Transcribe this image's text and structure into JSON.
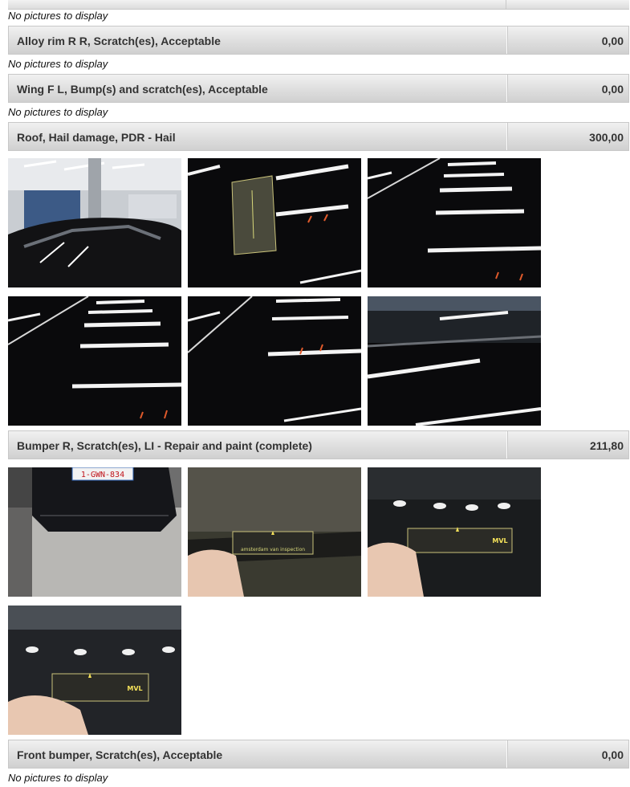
{
  "no_pictures_text": "No pictures to display",
  "damages": [
    {
      "title": "Alloy rim R R, Scratch(es), Acceptable",
      "amount": "0,00"
    },
    {
      "title": "Wing F L, Bump(s) and scratch(es), Acceptable",
      "amount": "0,00"
    },
    {
      "title": "Roof, Hail damage, PDR - Hail",
      "amount": "300,00"
    },
    {
      "title": "Bumper R, Scratch(es), LI - Repair and paint (complete)",
      "amount": "211,80"
    },
    {
      "title": "Front bumper, Scratch(es), Acceptable",
      "amount": "0,00"
    }
  ],
  "photos": {
    "license_plate": "1-GWN-834",
    "ruler_brand": "MVL",
    "ruler_text": "amsterdam van inspection"
  }
}
